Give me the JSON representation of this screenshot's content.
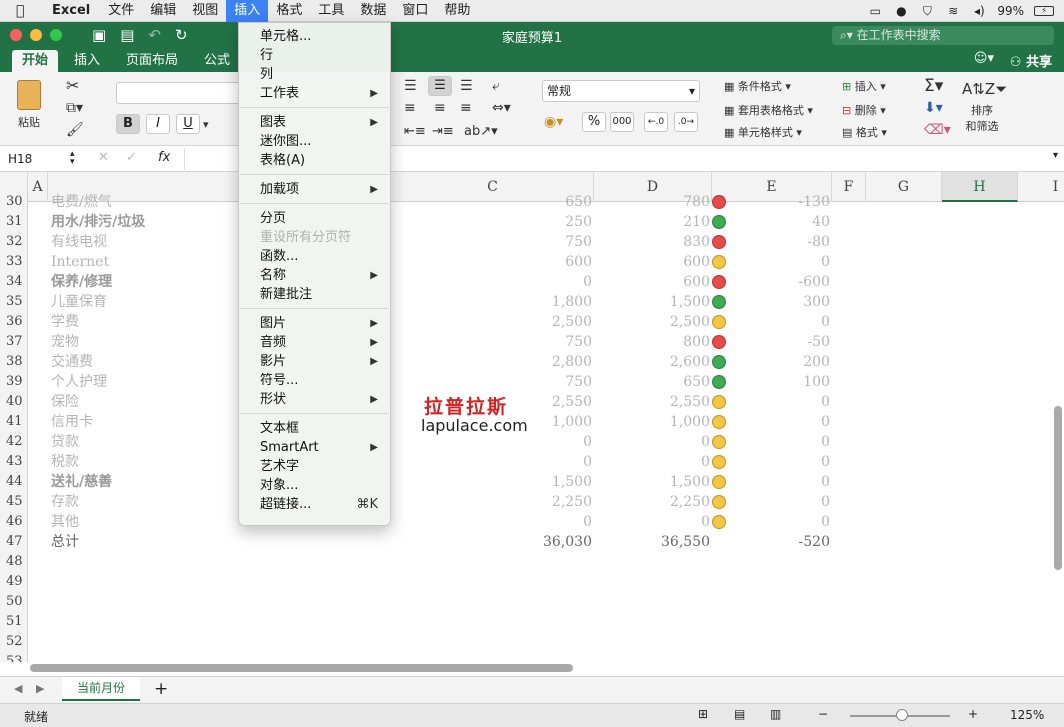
{
  "menubar": {
    "apple_icon": "apple-logo",
    "items": [
      "Excel",
      "文件",
      "编辑",
      "视图",
      "插入",
      "格式",
      "工具",
      "数据",
      "窗口",
      "帮助"
    ],
    "active_index": 4,
    "battery": "99%"
  },
  "window": {
    "title": "家庭预算1",
    "search_placeholder": "在工作表中搜索"
  },
  "ribbon_tabs": {
    "items": [
      "开始",
      "插入",
      "页面布局",
      "公式"
    ],
    "active_index": 0,
    "share_label": "共享"
  },
  "ribbon": {
    "paste_label": "粘贴",
    "bold": "B",
    "italic": "I",
    "underline": "U",
    "number_format": "常规",
    "percent": "%",
    "thousands": "000",
    "cond_format": "条件格式",
    "table_format": "套用表格格式",
    "cell_style": "单元格样式",
    "insert": "插入",
    "delete": "删除",
    "format": "格式",
    "sort_filter_line1": "排序",
    "sort_filter_line2": "和筛选"
  },
  "formula_bar": {
    "name_box": "H18",
    "fx": "fx"
  },
  "columns": [
    "A",
    "C",
    "D",
    "E",
    "F",
    "G",
    "H",
    "I"
  ],
  "selected_column": "H",
  "rows": [
    {
      "n": "30",
      "label": "电费/燃气",
      "bold": false,
      "c": "650",
      "d": "780",
      "status": "red",
      "e": "-130"
    },
    {
      "n": "31",
      "label": "用水/排污/垃圾",
      "bold": true,
      "c": "250",
      "d": "210",
      "status": "green",
      "e": "40"
    },
    {
      "n": "32",
      "label": "有线电视",
      "bold": false,
      "c": "750",
      "d": "830",
      "status": "red",
      "e": "-80"
    },
    {
      "n": "33",
      "label": "Internet",
      "bold": false,
      "c": "600",
      "d": "600",
      "status": "yellow",
      "e": "0"
    },
    {
      "n": "34",
      "label": "保养/修理",
      "bold": true,
      "c": "0",
      "d": "600",
      "status": "red",
      "e": "-600"
    },
    {
      "n": "35",
      "label": "儿童保育",
      "bold": false,
      "c": "1,800",
      "d": "1,500",
      "status": "green",
      "e": "300"
    },
    {
      "n": "36",
      "label": "学费",
      "bold": false,
      "c": "2,500",
      "d": "2,500",
      "status": "yellow",
      "e": "0"
    },
    {
      "n": "37",
      "label": "宠物",
      "bold": false,
      "c": "750",
      "d": "800",
      "status": "red",
      "e": "-50"
    },
    {
      "n": "38",
      "label": "交通费",
      "bold": false,
      "c": "2,800",
      "d": "2,600",
      "status": "green",
      "e": "200"
    },
    {
      "n": "39",
      "label": "个人护理",
      "bold": false,
      "c": "750",
      "d": "650",
      "status": "green",
      "e": "100"
    },
    {
      "n": "40",
      "label": "保险",
      "bold": false,
      "c": "2,550",
      "d": "2,550",
      "status": "yellow",
      "e": "0"
    },
    {
      "n": "41",
      "label": "信用卡",
      "bold": false,
      "c": "1,000",
      "d": "1,000",
      "status": "yellow",
      "e": "0"
    },
    {
      "n": "42",
      "label": "贷款",
      "bold": false,
      "c": "0",
      "d": "0",
      "status": "yellow",
      "e": "0"
    },
    {
      "n": "43",
      "label": "税款",
      "bold": false,
      "c": "0",
      "d": "0",
      "status": "yellow",
      "e": "0"
    },
    {
      "n": "44",
      "label": "送礼/慈善",
      "bold": true,
      "c": "1,500",
      "d": "1,500",
      "status": "yellow",
      "e": "0"
    },
    {
      "n": "45",
      "label": "存款",
      "bold": false,
      "c": "2,250",
      "d": "2,250",
      "status": "yellow",
      "e": "0"
    },
    {
      "n": "46",
      "label": "其他",
      "bold": false,
      "c": "0",
      "d": "0",
      "status": "yellow",
      "e": "0"
    },
    {
      "n": "47",
      "label": "总计",
      "bold": false,
      "total": true,
      "c": "36,030",
      "d": "36,550",
      "status": "",
      "e": "-520"
    },
    {
      "n": "48",
      "label": "",
      "c": "",
      "d": "",
      "status": "",
      "e": ""
    },
    {
      "n": "49",
      "label": "",
      "c": "",
      "d": "",
      "status": "",
      "e": ""
    },
    {
      "n": "50",
      "label": "",
      "c": "",
      "d": "",
      "status": "",
      "e": ""
    },
    {
      "n": "51",
      "label": "",
      "c": "",
      "d": "",
      "status": "",
      "e": ""
    },
    {
      "n": "52",
      "label": "",
      "c": "",
      "d": "",
      "status": "",
      "e": ""
    },
    {
      "n": "53",
      "label": "",
      "c": "",
      "d": "",
      "status": "",
      "e": ""
    }
  ],
  "status_colors": {
    "red": "#e84a4a",
    "green": "#3cab54",
    "yellow": "#f5c63f"
  },
  "insert_menu": [
    {
      "label": "单元格...",
      "arrow": false
    },
    {
      "label": "行",
      "arrow": false
    },
    {
      "label": "列",
      "arrow": false
    },
    {
      "label": "工作表",
      "arrow": true
    },
    {
      "sep": true
    },
    {
      "label": "图表",
      "arrow": true
    },
    {
      "label": "迷你图...",
      "arrow": false
    },
    {
      "label": "表格(A)",
      "arrow": false
    },
    {
      "sep": true
    },
    {
      "label": "加载项",
      "arrow": true
    },
    {
      "sep": true
    },
    {
      "label": "分页",
      "arrow": false
    },
    {
      "label": "重设所有分页符",
      "arrow": false,
      "disabled": true
    },
    {
      "label": "函数...",
      "arrow": false
    },
    {
      "label": "名称",
      "arrow": true
    },
    {
      "label": "新建批注",
      "arrow": false
    },
    {
      "sep": true
    },
    {
      "label": "图片",
      "arrow": true
    },
    {
      "label": "音频",
      "arrow": true
    },
    {
      "label": "影片",
      "arrow": true
    },
    {
      "label": "符号...",
      "arrow": false
    },
    {
      "label": "形状",
      "arrow": true
    },
    {
      "sep": true
    },
    {
      "label": "文本框",
      "arrow": false
    },
    {
      "label": "SmartArt",
      "arrow": true
    },
    {
      "label": "艺术字",
      "arrow": false
    },
    {
      "label": "对象...",
      "arrow": false
    },
    {
      "label": "超链接...",
      "arrow": false,
      "shortcut": "⌘K"
    }
  ],
  "watermark": {
    "line1": "拉普拉斯",
    "line2": "lapulace.com"
  },
  "sheet": {
    "tab_label": "当前月份",
    "add": "+"
  },
  "statusbar": {
    "ready": "就绪",
    "zoom": "125%"
  }
}
